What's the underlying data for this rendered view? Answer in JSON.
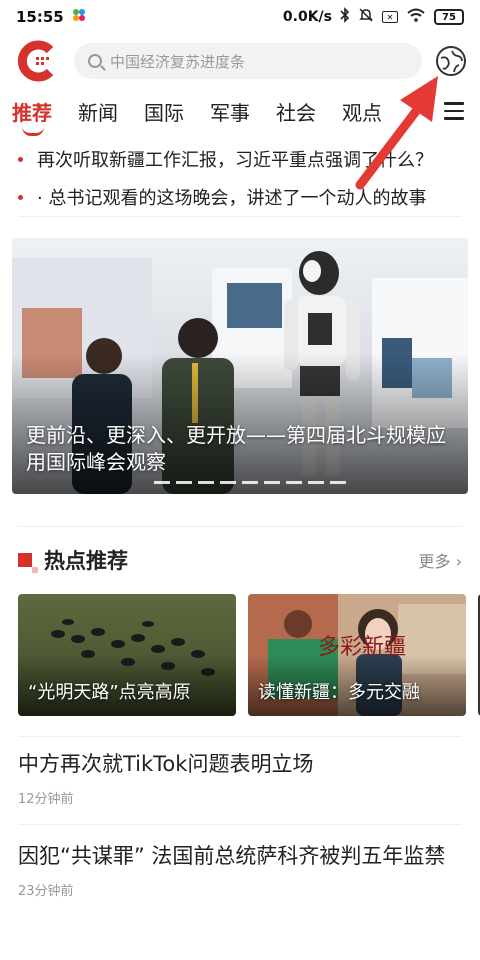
{
  "status": {
    "time": "15:55",
    "speed": "0.0K/s",
    "battery": "75"
  },
  "search": {
    "placeholder": "中国经济复苏进度条"
  },
  "tabs": [
    {
      "label": "推荐"
    },
    {
      "label": "新闻"
    },
    {
      "label": "国际"
    },
    {
      "label": "军事"
    },
    {
      "label": "社会"
    },
    {
      "label": "观点"
    }
  ],
  "headlines": [
    {
      "text": "再次听取新疆工作汇报，习近平重点强调了什么？"
    },
    {
      "text": "· 总书记观看的这场晚会，讲述了一个动人的故事"
    }
  ],
  "hero": {
    "caption": "更前沿、更深入、更开放——第四届北斗规模应用国际峰会观察"
  },
  "hot_section": {
    "title": "热点推荐",
    "more": "更多"
  },
  "hot_cards": [
    {
      "title": "“光明天路”点亮高原"
    },
    {
      "title": "读懂新疆：多元交融"
    }
  ],
  "news": [
    {
      "title": "中方再次就TikTok问题表明立场",
      "time": "12分钟前"
    },
    {
      "title": "因犯“共谋罪” 法国前总统萨科齐被判五年监禁",
      "time": "23分钟前"
    }
  ],
  "colors": {
    "accent": "#d6322d"
  }
}
